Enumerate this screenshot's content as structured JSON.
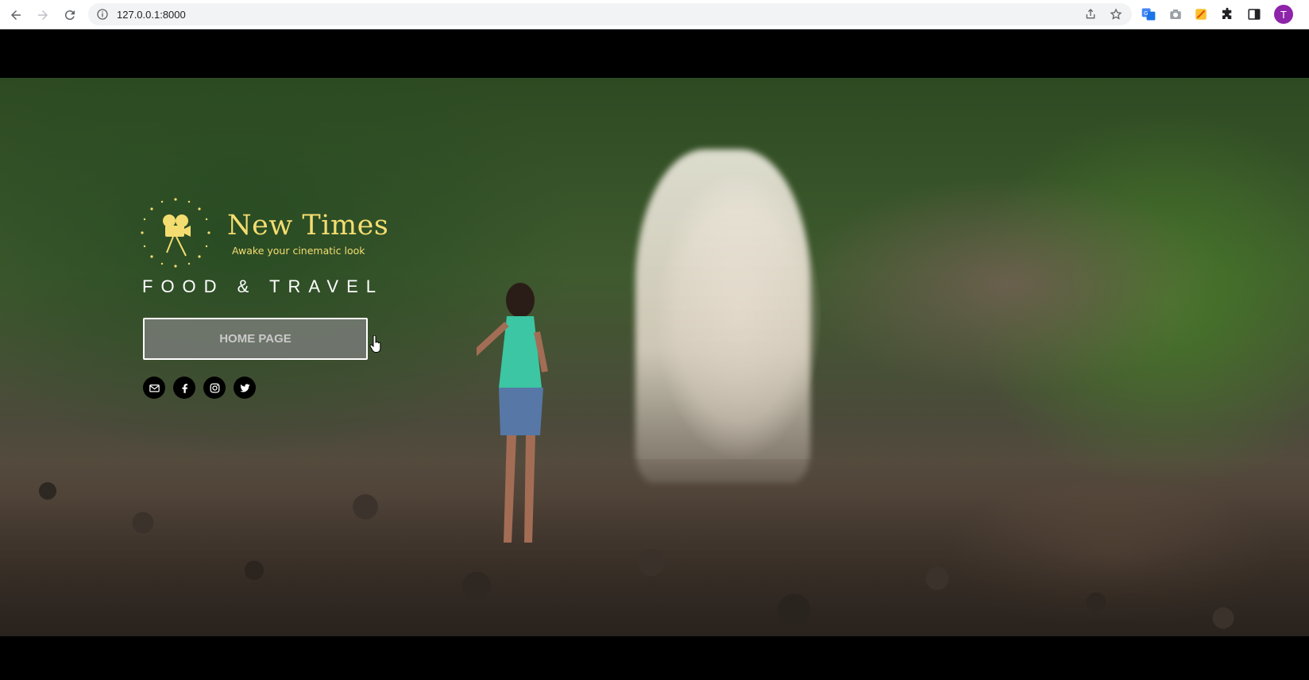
{
  "browser": {
    "url": "127.0.0.1:8000",
    "avatar_letter": "T"
  },
  "brand": {
    "title": "New Times",
    "tagline": "Awake your cinematic look",
    "color": "#f4dd70"
  },
  "section_label": "FOOD & TRAVEL",
  "hero": {
    "button_label": "HOME PAGE"
  },
  "social": [
    "mail-icon",
    "facebook-icon",
    "instagram-icon",
    "twitter-icon"
  ]
}
